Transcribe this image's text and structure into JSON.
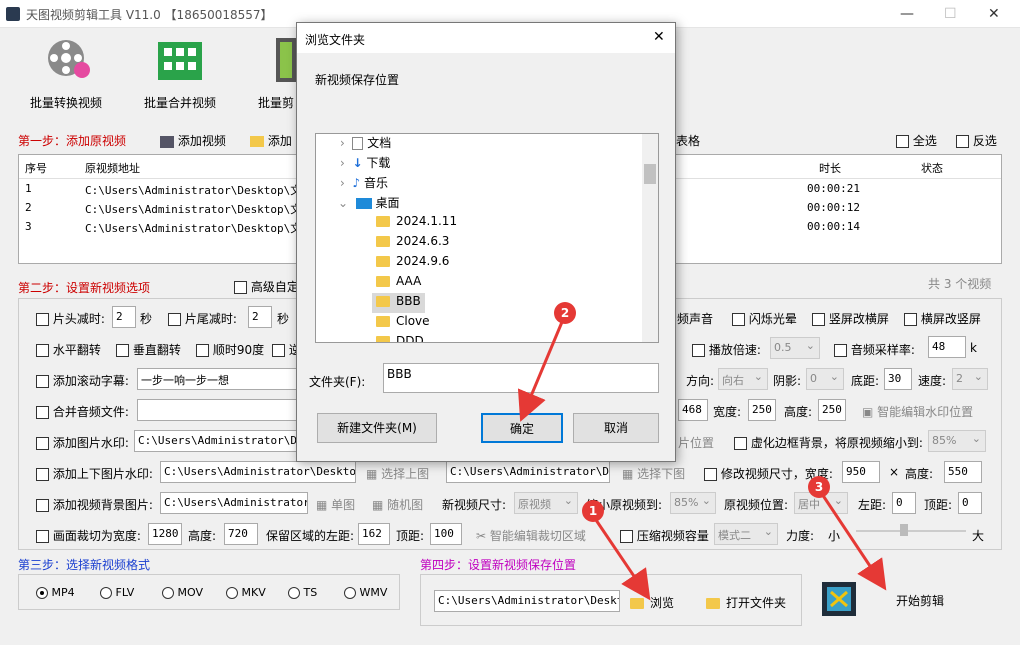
{
  "app": {
    "title": "天图视频剪辑工具 V11.0 【18650018557】"
  },
  "toolbar": {
    "items": [
      {
        "label": "批量转换视频"
      },
      {
        "label": "批量合并视频"
      },
      {
        "label": "批量剪"
      }
    ]
  },
  "step1": {
    "label": "第一步：添加原视频",
    "add_video": "添加视频",
    "add_more": "添加",
    "grid_tail": "表格",
    "select_all": "全选",
    "invert": "反选"
  },
  "table": {
    "headers": {
      "index": "序号",
      "path": "原视频地址",
      "duration": "时长",
      "status": "状态"
    },
    "rows": [
      {
        "index": "1",
        "path": "C:\\Users\\Administrator\\Desktop\\文豪",
        "duration": "00:00:21"
      },
      {
        "index": "2",
        "path": "C:\\Users\\Administrator\\Desktop\\文豪",
        "duration": "00:00:12"
      },
      {
        "index": "3",
        "path": "C:\\Users\\Administrator\\Desktop\\文豪",
        "duration": "00:00:14"
      }
    ],
    "count": "共 3 个视频"
  },
  "step2": {
    "label": "第二步：设置新视频选项",
    "advanced": "高级自定"
  },
  "opts": {
    "head_cut": "片头减时:",
    "head_val": "2",
    "sec": "秒",
    "tail_cut": "片尾减时:",
    "tail_val": "2",
    "sec2": "秒",
    "audio": "频声音",
    "flash": "闪烁光晕",
    "v2h": "竖屏改横屏",
    "h2v": "横屏改竖屏",
    "hflip": "水平翻转",
    "vflip": "垂直翻转",
    "rot90": "顺时90度",
    "rot_tail": "逆",
    "speed": "播放倍速:",
    "speed_val": "0.5",
    "sample": "音频采样率:",
    "sample_val": "48",
    "k": "k",
    "scroll_sub": "添加滚动字幕:",
    "scroll_val": "一步一响一步一想",
    "dir": "方向:",
    "dir_val": "向右",
    "shadow": "阴影:",
    "shadow_val": "0",
    "bottom": "底距:",
    "bottom_val": "30",
    "spd": "速度:",
    "spd_val": "2",
    "merge_audio": "合并音频文件:",
    "w468": "468",
    "width": "宽度:",
    "width_val": "250",
    "height": "高度:",
    "height_val": "250",
    "smart_wm": "智能编辑水印位置",
    "img_wm": "添加图片水印:",
    "img_wm_path": "C:\\Users\\Administrator\\Des",
    "pos_tail": "片位置",
    "blur_bg": "虚化边框背景，将原视频缩小到:",
    "blur_val": "85%",
    "tb_wm": "添加上下图片水印:",
    "tb_path1": "C:\\Users\\Administrator\\Desktop\\A",
    "sel_top": "选择上图",
    "tb_path2": "C:\\Users\\Administrator\\Desk",
    "sel_bottom": "选择下图",
    "resize": "修改视频尺寸，宽度:",
    "resize_w": "950",
    "x": "×",
    "resize_h_lbl": "高度:",
    "resize_h": "550",
    "bg_img": "添加视频背景图片:",
    "bg_path": "C:\\Users\\Administrator\\D",
    "single": "单图",
    "random": "随机图",
    "new_size": "新视频尺寸:",
    "new_size_val": "原视频",
    "shrink": "缩小原视频到:",
    "shrink_val": "85%",
    "pos": "原视频位置:",
    "pos_val": "居中",
    "left": "左距:",
    "left_val": "0",
    "top": "顶距:",
    "top_val": "0",
    "crop": "画面裁切为宽度:",
    "crop_w": "1280",
    "crop_h_lbl": "高度:",
    "crop_h": "720",
    "keep_left": "保留区域的左距:",
    "keep_left_val": "162",
    "keep_top": "顶距:",
    "keep_top_val": "100",
    "smart_crop": "智能编辑裁切区域",
    "compress": "压缩视频容量",
    "mode": "模式二",
    "strength": "力度:",
    "small": "小",
    "big": "大"
  },
  "step3": {
    "label": "第三步：选择新视频格式",
    "formats": [
      "MP4",
      "FLV",
      "MOV",
      "MKV",
      "TS",
      "WMV"
    ]
  },
  "step4": {
    "label": "第四步：设置新视频保存位置",
    "path": "C:\\Users\\Administrator\\Desktop",
    "browse": "浏览",
    "open_folder": "打开文件夹",
    "start": "开始剪辑"
  },
  "dialog": {
    "title": "浏览文件夹",
    "subtitle": "新视频保存位置",
    "tree": [
      {
        "label": "文档"
      },
      {
        "label": "下载"
      },
      {
        "label": "音乐"
      },
      {
        "label": "桌面"
      },
      {
        "label": "2024.1.11"
      },
      {
        "label": "2024.6.3"
      },
      {
        "label": "2024.9.6"
      },
      {
        "label": "AAA"
      },
      {
        "label": "BBB"
      },
      {
        "label": "Clove"
      },
      {
        "label": "DDD"
      }
    ],
    "folder_lbl": "文件夹(F):",
    "folder_val": "BBB",
    "new_folder": "新建文件夹(M)",
    "ok": "确定",
    "cancel": "取消"
  },
  "markers": [
    "1",
    "2",
    "3"
  ]
}
